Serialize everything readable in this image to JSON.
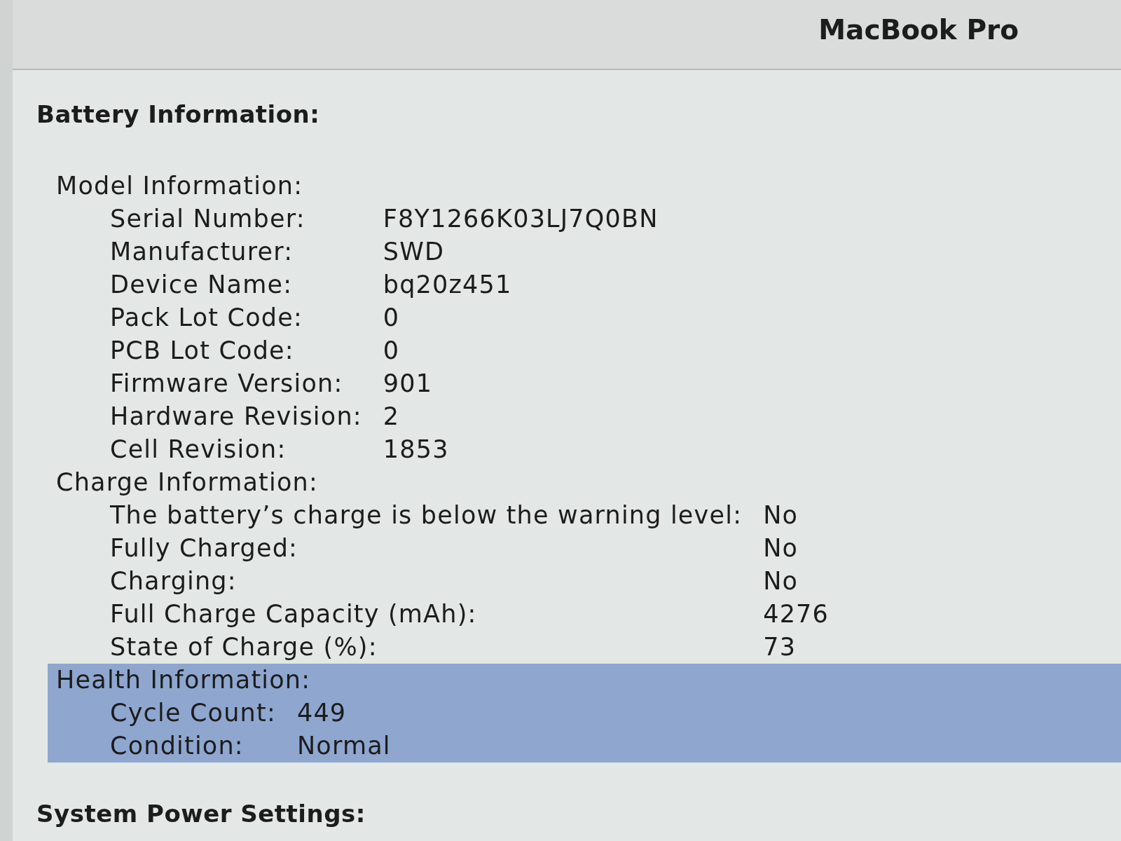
{
  "header": {
    "title": "MacBook Pro"
  },
  "sections": [
    {
      "title": "Battery Information:",
      "groups": [
        {
          "title": "Model Information:",
          "selected": false,
          "rows": [
            {
              "label": "Serial Number:",
              "value": "F8Y1266K03LJ7Q0BN"
            },
            {
              "label": "Manufacturer:",
              "value": "SWD"
            },
            {
              "label": "Device Name:",
              "value": "bq20z451"
            },
            {
              "label": "Pack Lot Code:",
              "value": "0"
            },
            {
              "label": "PCB Lot Code:",
              "value": "0"
            },
            {
              "label": "Firmware Version:",
              "value": "901"
            },
            {
              "label": "Hardware Revision:",
              "value": "2"
            },
            {
              "label": "Cell Revision:",
              "value": "1853"
            }
          ]
        },
        {
          "title": "Charge Information:",
          "selected": false,
          "rows": [
            {
              "label": "The battery’s charge is below the warning level:",
              "value": "No"
            },
            {
              "label": "Fully Charged:",
              "value": "No"
            },
            {
              "label": "Charging:",
              "value": "No"
            },
            {
              "label": "Full Charge Capacity (mAh):",
              "value": "4276"
            },
            {
              "label": "State of Charge (%):",
              "value": "73"
            }
          ]
        },
        {
          "title": "Health Information:",
          "selected": true,
          "rows": [
            {
              "label": "Cycle Count:",
              "value": "449"
            },
            {
              "label": "Condition:",
              "value": "Normal"
            }
          ]
        }
      ]
    },
    {
      "title": "System Power Settings:"
    }
  ]
}
